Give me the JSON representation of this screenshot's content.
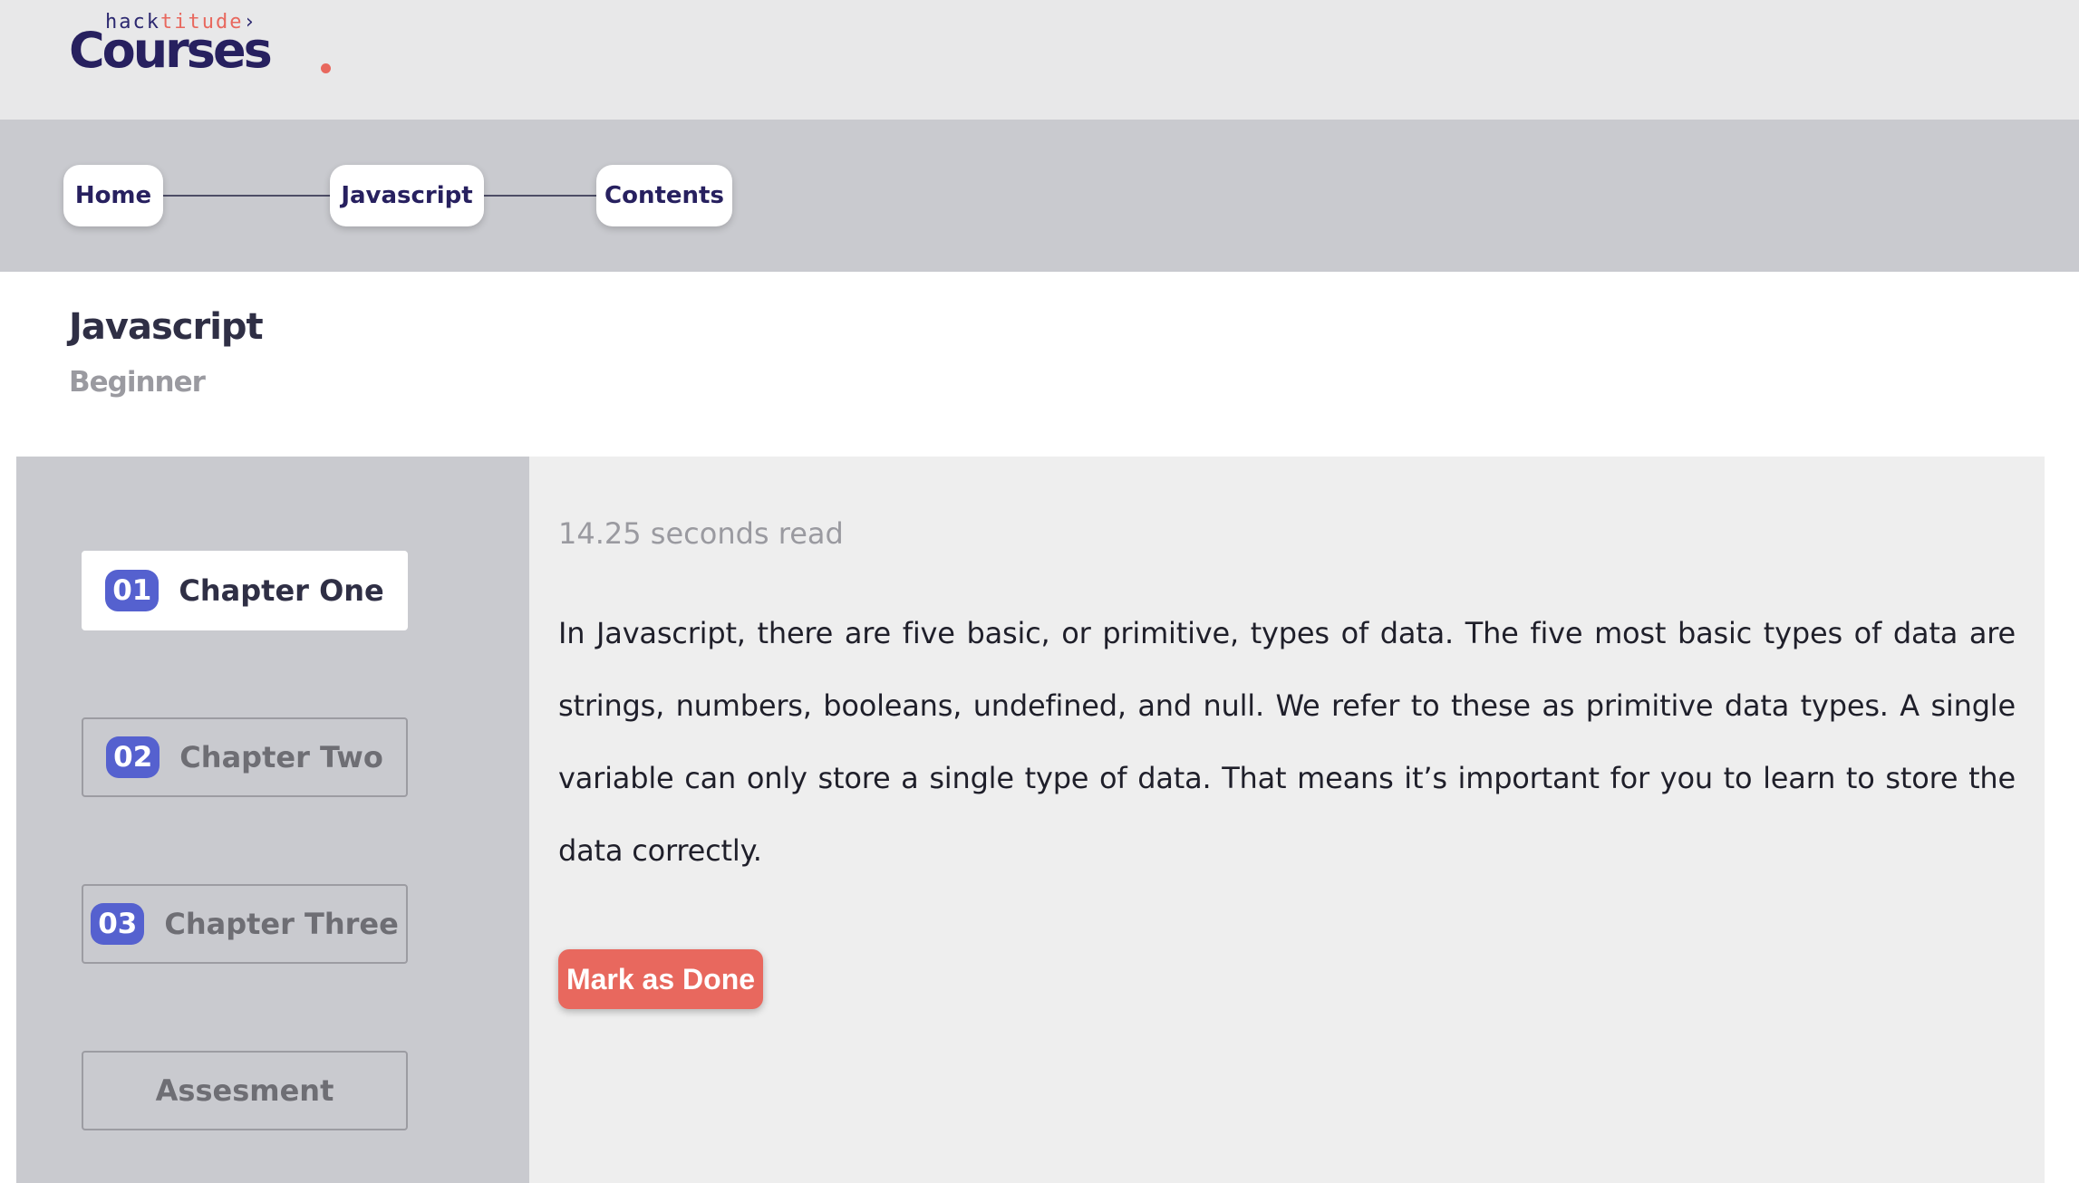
{
  "logo": {
    "small_a": "hack",
    "small_b": "titude",
    "small_c": "›",
    "big": "Courses",
    "colors": {
      "primary": "#27205f",
      "accent": "#e8685e"
    }
  },
  "breadcrumb": {
    "items": [
      {
        "label": "Home"
      },
      {
        "label": "Javascript"
      },
      {
        "label": "Contents"
      }
    ]
  },
  "course": {
    "title": "Javascript",
    "level": "Beginner"
  },
  "sidebar": {
    "items": [
      {
        "number": "01",
        "label": "Chapter One",
        "active": true
      },
      {
        "number": "02",
        "label": "Chapter Two",
        "active": false
      },
      {
        "number": "03",
        "label": "Chapter Three",
        "active": false
      },
      {
        "number": "",
        "label": "Assesment",
        "active": false
      }
    ],
    "number_badge_color": "#5561cf"
  },
  "content": {
    "read_time": "14.25 seconds read",
    "body": "In Javascript, there are five basic, or primitive, types of data. The five most basic types of data are strings, numbers, booleans, undefined, and null. We refer to these as primitive data types. A single variable can only store a single type of data. That means it’s important for you to learn to store the data correctly.",
    "mark_done_label": "Mark as Done",
    "button_color": "#e8685e"
  }
}
